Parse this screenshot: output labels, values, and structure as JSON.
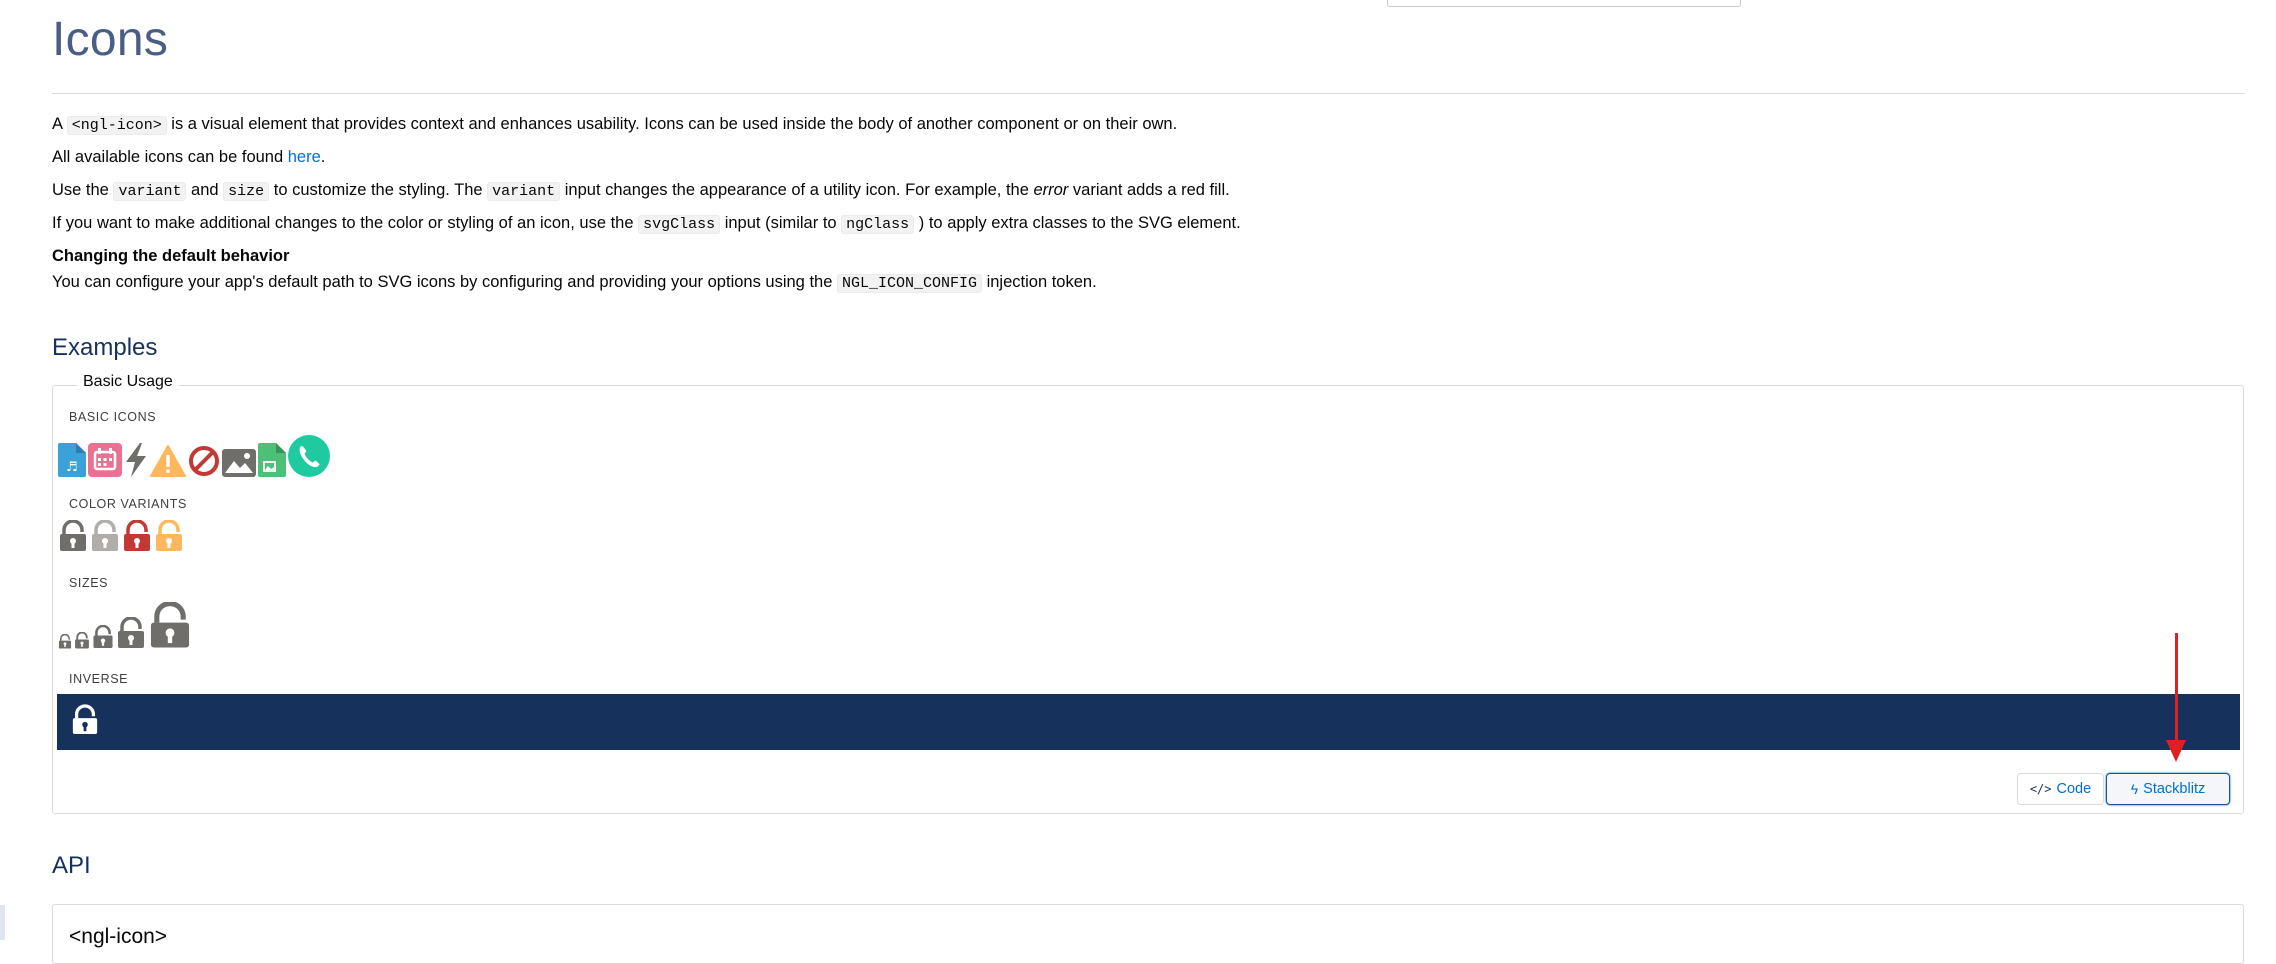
{
  "page": {
    "title": "Icons"
  },
  "intro": {
    "p1_pre": "A ",
    "p1_code": "<ngl-icon>",
    "p1_post": " is a visual element that provides context and enhances usability. Icons can be used inside the body of another component or on their own.",
    "p2_pre": "All available icons can be found ",
    "p2_link": "here",
    "p2_post": ".",
    "p3_a": "Use the ",
    "p3_code1": "variant",
    "p3_b": " and ",
    "p3_code2": "size",
    "p3_c": " to customize the styling. The ",
    "p3_code3": "variant",
    "p3_d": " input changes the appearance of a utility icon. For example, the ",
    "p3_em": "error",
    "p3_e": " variant adds a red fill.",
    "p4_a": "If you want to make additional changes to the color or styling of an icon, use the ",
    "p4_code1": "svgClass",
    "p4_b": " input (similar to ",
    "p4_code2": "ngClass",
    "p4_c": " ) to apply extra classes to the SVG element.",
    "p5_heading": "Changing the default behavior",
    "p6_a": "You can configure your app's default path to SVG icons by configuring and providing your options using the ",
    "p6_code": "NGL_ICON_CONFIG",
    "p6_b": " injection token."
  },
  "examples": {
    "heading": "Examples",
    "legend": "Basic Usage",
    "sections": {
      "basic": "BASIC ICONS",
      "color": "COLOR VARIANTS",
      "sizes": "SIZES",
      "inverse": "INVERSE"
    },
    "basic_icons": [
      "audio-file-icon",
      "event-calendar-icon",
      "lightning-icon",
      "warning-icon",
      "ban-icon",
      "image-icon",
      "image-file-icon",
      "call-icon"
    ],
    "colors": {
      "brand": "#16325c",
      "link": "#0070d2",
      "error": "#c23934",
      "warning": "#ffb75d",
      "default": "#706e6b",
      "light": "#b0adab",
      "annotation": "#e02020"
    },
    "buttons": {
      "code": "Code",
      "stackblitz": "Stackblitz"
    }
  },
  "api": {
    "heading": "API",
    "component": "<ngl-icon>"
  }
}
